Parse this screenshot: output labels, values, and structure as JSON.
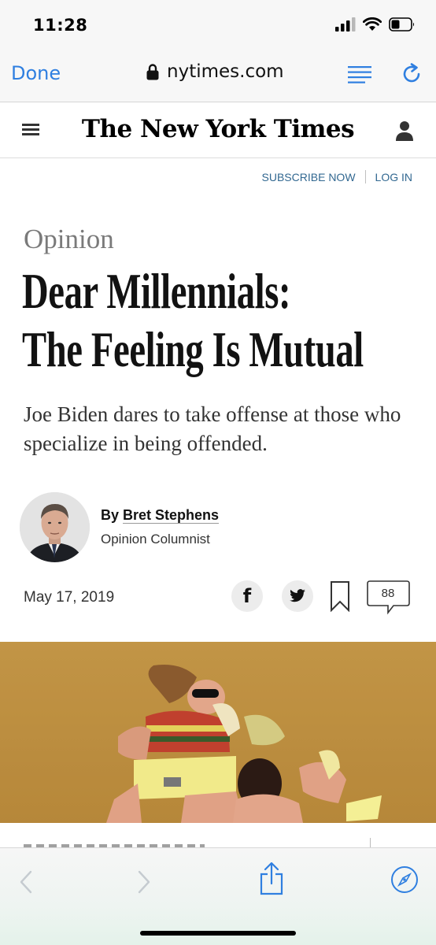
{
  "status_bar": {
    "time": "11:28",
    "icons": [
      "cellular-signal-icon",
      "wifi-icon",
      "battery-icon"
    ]
  },
  "browser": {
    "done_label": "Done",
    "url": "nytimes.com",
    "icons": [
      "lock-icon",
      "reader-view-icon",
      "reload-icon"
    ],
    "accent_color": "#2f7fe0"
  },
  "site_header": {
    "logo": "The New York Times",
    "icons": [
      "hamburger-menu-icon",
      "account-icon"
    ],
    "subscribe_label": "SUBSCRIBE NOW",
    "login_label": "LOG IN",
    "link_color": "#326891"
  },
  "article": {
    "kicker": "Opinion",
    "headline_lines": [
      "Dear Millennials:",
      "The Feeling Is Mutual"
    ],
    "summary": "Joe Biden dares to take offense at those who specialize in being offended.",
    "byline": {
      "prefix": "By",
      "author": "Bret Stephens",
      "role": "Opinion Columnist"
    },
    "date": "May 17, 2019",
    "share": {
      "facebook_glyph": "f",
      "icons": [
        "facebook-icon",
        "twitter-icon",
        "bookmark-icon",
        "comments-icon"
      ],
      "comment_count": "88"
    }
  },
  "bottom_toolbar": {
    "icons": [
      "back-icon",
      "forward-icon",
      "share-icon",
      "compass-icon"
    ]
  }
}
